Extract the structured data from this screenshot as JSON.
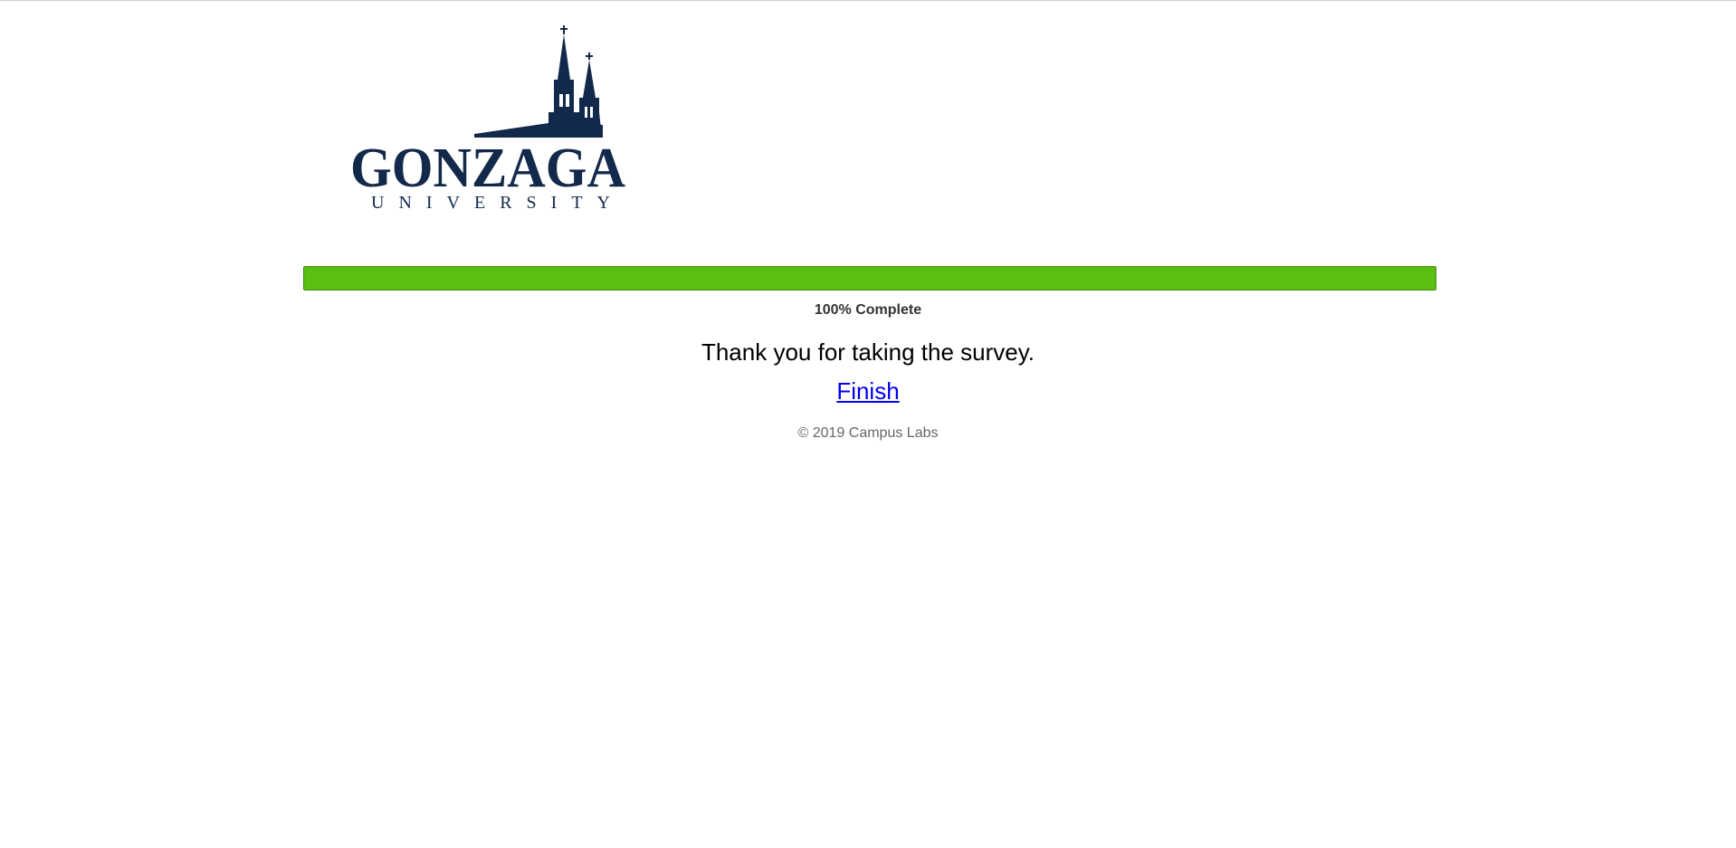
{
  "logo": {
    "name": "GONZAGA",
    "subtitle": "UNIVERSITY",
    "color": "#13294b"
  },
  "progress": {
    "percent": 100,
    "label": "100% Complete",
    "fill_color": "#5bbf12"
  },
  "message": {
    "thanks": "Thank you for taking the survey."
  },
  "actions": {
    "finish_label": "Finish"
  },
  "footer": {
    "copyright": "© 2019 Campus Labs"
  }
}
